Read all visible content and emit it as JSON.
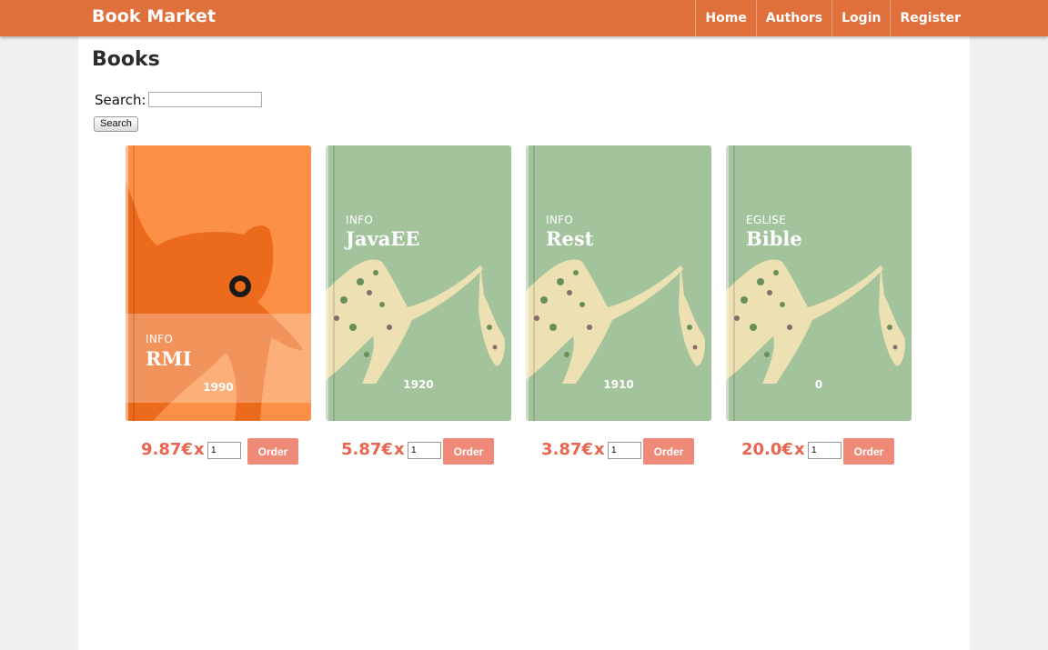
{
  "brand": "Book Market",
  "nav": [
    "Home",
    "Authors",
    "Login",
    "Register"
  ],
  "page_title": "Books",
  "search": {
    "label": "Search:",
    "value": "",
    "button": "Search"
  },
  "books": [
    {
      "category": "INFO",
      "title": "RMI",
      "year": "1990",
      "price": "9.87€",
      "qty": "1",
      "order": "Order",
      "cover": "#fd9047"
    },
    {
      "category": "INFO",
      "title": "JavaEE",
      "year": "1920",
      "price": "5.87€",
      "qty": "1",
      "order": "Order",
      "cover": "#a3c39d"
    },
    {
      "category": "INFO",
      "title": "Rest",
      "year": "1910",
      "price": "3.87€",
      "qty": "1",
      "order": "Order",
      "cover": "#a3c39d"
    },
    {
      "category": "EGLISE",
      "title": "Bible",
      "year": "0",
      "price": "20.0€",
      "qty": "1",
      "order": "Order",
      "cover": "#a3c39d"
    }
  ],
  "multiplier": "x"
}
